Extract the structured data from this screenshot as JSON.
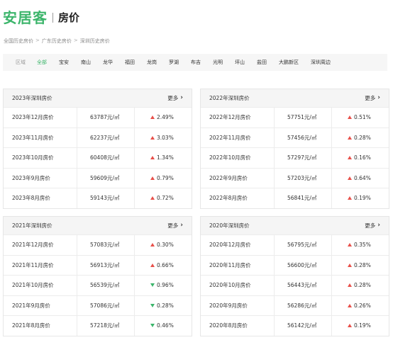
{
  "header": {
    "logo": "安居客",
    "title": "房价"
  },
  "breadcrumb": [
    "全国历史房价",
    "广东历史房价",
    "深圳历史房价"
  ],
  "breadcrumb_sep": ">",
  "districts": {
    "label": "区域",
    "items": [
      "全部",
      "宝安",
      "南山",
      "龙华",
      "福田",
      "龙岗",
      "罗湖",
      "布吉",
      "光明",
      "坪山",
      "盐田",
      "大鹏新区",
      "深圳周边"
    ],
    "active": "全部"
  },
  "colors": {
    "brand": "#3cb56b",
    "up": "#e8504a",
    "down": "#3cb56b"
  },
  "panels": [
    {
      "title": "2023年深圳房价",
      "more": "更多",
      "rows": [
        {
          "month": "2023年12月房价",
          "price": "63787元/㎡",
          "dir": "up",
          "change": "2.49%"
        },
        {
          "month": "2023年11月房价",
          "price": "62237元/㎡",
          "dir": "up",
          "change": "3.03%"
        },
        {
          "month": "2023年10月房价",
          "price": "60408元/㎡",
          "dir": "up",
          "change": "1.34%"
        },
        {
          "month": "2023年9月房价",
          "price": "59609元/㎡",
          "dir": "up",
          "change": "0.79%"
        },
        {
          "month": "2023年8月房价",
          "price": "59143元/㎡",
          "dir": "up",
          "change": "0.72%"
        }
      ]
    },
    {
      "title": "2022年深圳房价",
      "more": "更多",
      "rows": [
        {
          "month": "2022年12月房价",
          "price": "57751元/㎡",
          "dir": "up",
          "change": "0.51%"
        },
        {
          "month": "2022年11月房价",
          "price": "57456元/㎡",
          "dir": "up",
          "change": "0.28%"
        },
        {
          "month": "2022年10月房价",
          "price": "57297元/㎡",
          "dir": "up",
          "change": "0.16%"
        },
        {
          "month": "2022年9月房价",
          "price": "57203元/㎡",
          "dir": "up",
          "change": "0.64%"
        },
        {
          "month": "2022年8月房价",
          "price": "56841元/㎡",
          "dir": "up",
          "change": "0.19%"
        }
      ]
    },
    {
      "title": "2021年深圳房价",
      "more": "更多",
      "rows": [
        {
          "month": "2021年12月房价",
          "price": "57083元/㎡",
          "dir": "up",
          "change": "0.30%"
        },
        {
          "month": "2021年11月房价",
          "price": "56913元/㎡",
          "dir": "up",
          "change": "0.66%"
        },
        {
          "month": "2021年10月房价",
          "price": "56539元/㎡",
          "dir": "down",
          "change": "0.96%"
        },
        {
          "month": "2021年9月房价",
          "price": "57086元/㎡",
          "dir": "down",
          "change": "0.28%"
        },
        {
          "month": "2021年8月房价",
          "price": "57218元/㎡",
          "dir": "down",
          "change": "0.46%"
        }
      ]
    },
    {
      "title": "2020年深圳房价",
      "more": "更多",
      "rows": [
        {
          "month": "2020年12月房价",
          "price": "56795元/㎡",
          "dir": "up",
          "change": "0.35%"
        },
        {
          "month": "2020年11月房价",
          "price": "56600元/㎡",
          "dir": "up",
          "change": "0.28%"
        },
        {
          "month": "2020年10月房价",
          "price": "56443元/㎡",
          "dir": "up",
          "change": "0.28%"
        },
        {
          "month": "2020年9月房价",
          "price": "56286元/㎡",
          "dir": "up",
          "change": "0.26%"
        },
        {
          "month": "2020年8月房价",
          "price": "56142元/㎡",
          "dir": "up",
          "change": "0.19%"
        }
      ]
    }
  ]
}
